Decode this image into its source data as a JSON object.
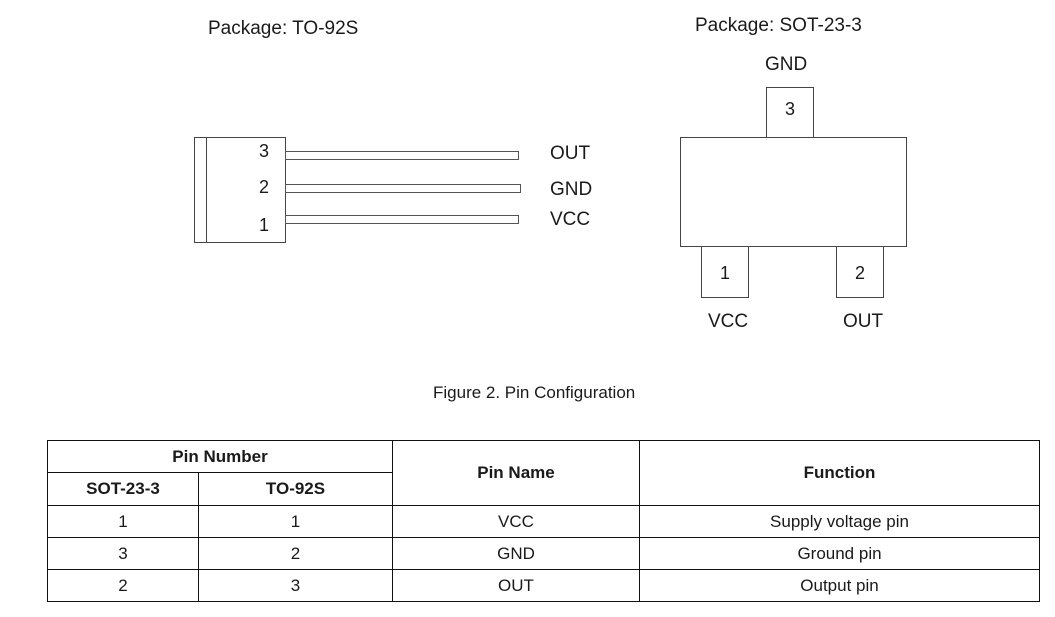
{
  "to92s": {
    "title": "Package: TO-92S",
    "pins": [
      {
        "number": "3",
        "name": "OUT"
      },
      {
        "number": "2",
        "name": "GND"
      },
      {
        "number": "1",
        "name": "VCC"
      }
    ]
  },
  "sot23": {
    "title": "Package: SOT-23-3",
    "top_pin": {
      "number": "3",
      "name": "GND"
    },
    "bottom_left_pin": {
      "number": "1",
      "name": "VCC"
    },
    "bottom_right_pin": {
      "number": "2",
      "name": "OUT"
    }
  },
  "caption": "Figure 2. Pin Configuration",
  "table": {
    "header_group": "Pin Number",
    "header_sot": "SOT-23-3",
    "header_to": "TO-92S",
    "header_name": "Pin Name",
    "header_function": "Function",
    "rows": [
      {
        "sot": "1",
        "to": "1",
        "name": "VCC",
        "function": "Supply voltage pin"
      },
      {
        "sot": "3",
        "to": "2",
        "name": "GND",
        "function": "Ground pin"
      },
      {
        "sot": "2",
        "to": "3",
        "name": "OUT",
        "function": "Output pin"
      }
    ]
  }
}
